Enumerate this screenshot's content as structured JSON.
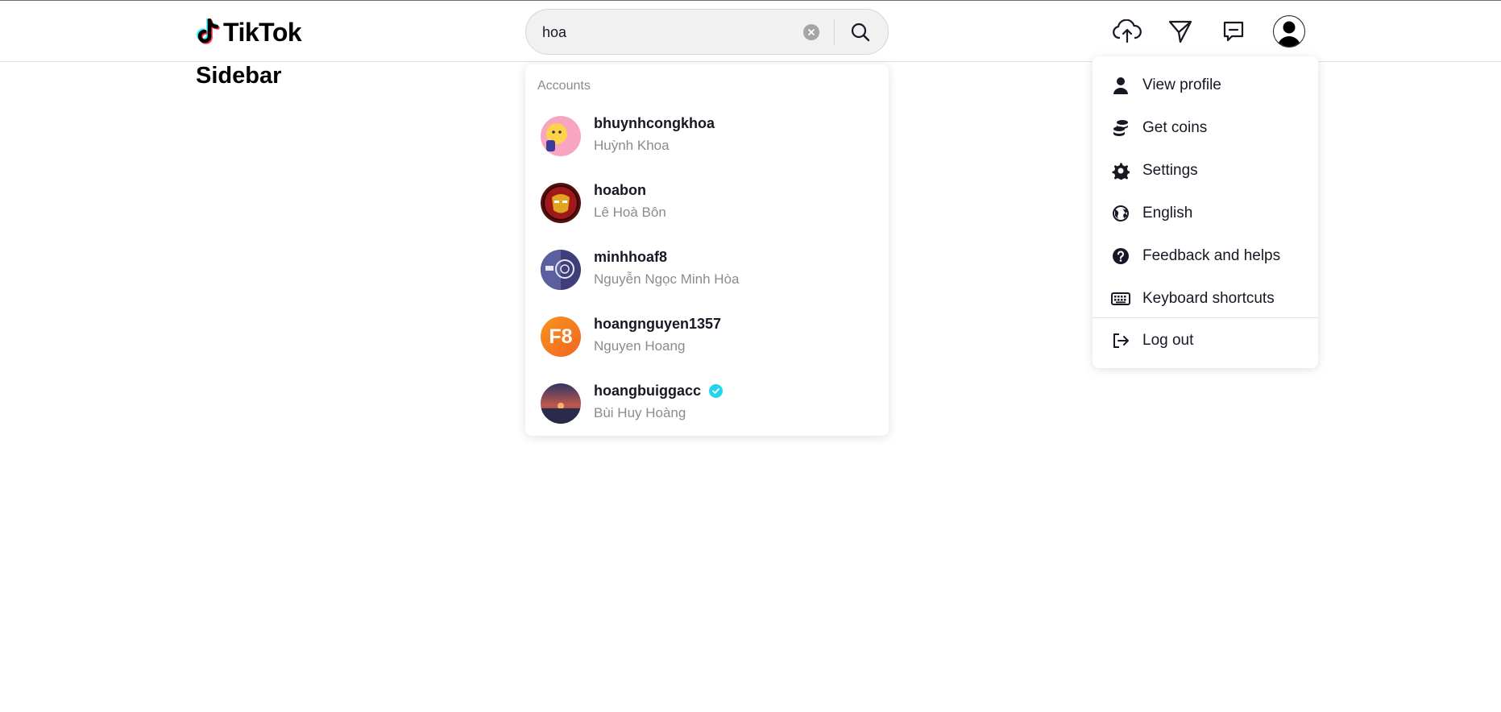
{
  "header": {
    "logo_text": "TikTok",
    "search": {
      "value": "hoa",
      "placeholder": ""
    },
    "icons": [
      "upload-icon",
      "paper-plane-icon",
      "inbox-icon",
      "avatar-icon"
    ]
  },
  "sidebar": {
    "title": "Sidebar"
  },
  "search_dropdown": {
    "heading": "Accounts",
    "accounts": [
      {
        "username": "bhuynhcongkhoa",
        "name": "Huỳnh Khoa",
        "verified": false,
        "avatar_color": "#f48fb1"
      },
      {
        "username": "hoabon",
        "name": "Lê Hoà Bôn",
        "verified": false,
        "avatar_color": "#8b1a1a"
      },
      {
        "username": "minhhoaf8",
        "name": "Nguyễn Ngọc Minh Hòa",
        "verified": false,
        "avatar_color": "#3f3d7a"
      },
      {
        "username": "hoangnguyen1357",
        "name": "Nguyen Hoang",
        "verified": false,
        "avatar_color": "#f26522",
        "avatar_text": "F8"
      },
      {
        "username": "hoangbuiggacc",
        "name": "Bùi Huy Hoàng",
        "verified": true,
        "avatar_color": "#3b3a5c"
      }
    ]
  },
  "profile_menu": {
    "items": [
      {
        "label": "View profile",
        "icon": "user-icon"
      },
      {
        "label": "Get coins",
        "icon": "coins-icon"
      },
      {
        "label": "Settings",
        "icon": "gear-icon"
      },
      {
        "label": "English",
        "icon": "language-icon"
      },
      {
        "label": "Feedback and helps",
        "icon": "help-icon"
      },
      {
        "label": "Keyboard shortcuts",
        "icon": "keyboard-icon"
      },
      {
        "label": "Log out",
        "icon": "logout-icon"
      }
    ]
  },
  "colors": {
    "accent": "#fe2c55",
    "cyan": "#25f4ee",
    "verified": "#20d5ec",
    "muted_text": "#8a8b91"
  }
}
